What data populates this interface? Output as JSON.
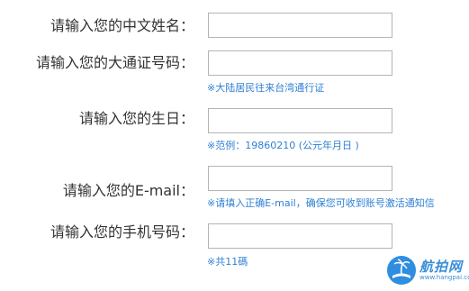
{
  "form": {
    "fields": [
      {
        "label": "请输入您的中文姓名：",
        "value": "",
        "hint": ""
      },
      {
        "label": "请输入您的大通证号码：",
        "value": "",
        "hint": "※大陆居民往来台湾通行证"
      },
      {
        "label": "请输入您的生日：",
        "value": "",
        "hint": "※范例：19860210 (公元年月日 )"
      },
      {
        "label": "请输入您的E-mail：",
        "value": "",
        "hint": "※请填入正确E-mail，确保您可收到账号激活通知信"
      },
      {
        "label": "请输入您的手机号码：",
        "value": "",
        "hint": "※共11碼"
      }
    ]
  },
  "watermark": {
    "title": "航拍网",
    "url": "www.hangpai.com",
    "icon": "palm-tree-logo-icon",
    "color": "#2f8ee0"
  }
}
